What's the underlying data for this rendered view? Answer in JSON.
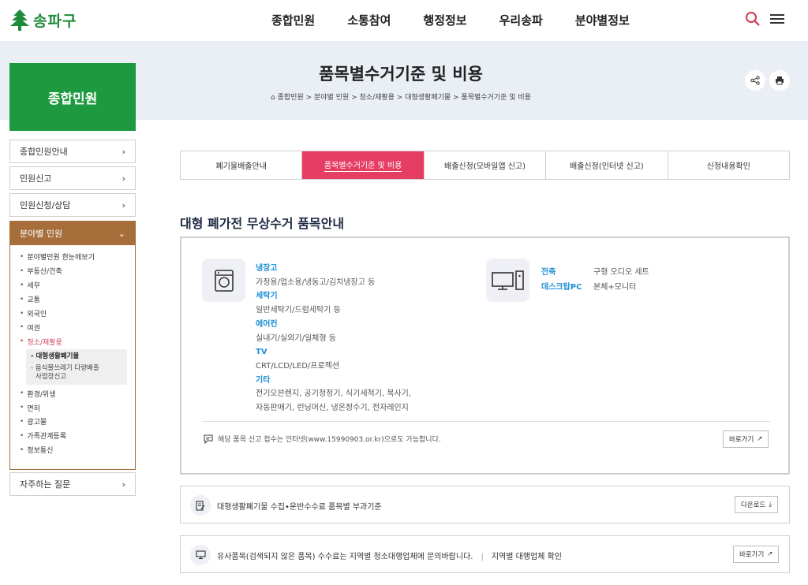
{
  "header": {
    "logo_text": "송파구",
    "nav": [
      "종합민원",
      "소통참여",
      "행정정보",
      "우리송파",
      "분야별정보"
    ],
    "search_icon_color": "#d2455e"
  },
  "page": {
    "title": "품목별수거기준 및 비용",
    "breadcrumb": "종합민원 > 분야별 민원 > 청소/재활용 > 대형생활폐기물 > 품목별수거기준 및 비용"
  },
  "lnb": {
    "title": "종합민원",
    "items_top": [
      "종합민원안내",
      "민원신고",
      "민원신청/상담"
    ],
    "active_label": "분야별 민원",
    "sub_items_a": [
      "분야별민원 한눈에보기",
      "부동산/건축",
      "세무",
      "교통",
      "외국인",
      "여권",
      "청소/재활용"
    ],
    "sub_sub_current": "- 대형생활폐기물",
    "sub_sub_other_1": "- 음식물쓰레기 다량배출",
    "sub_sub_other_2": "사업장신고",
    "sub_items_b": [
      "환경/위생",
      "면허",
      "광고물",
      "가족관계등록",
      "정보통신"
    ],
    "faq_label": "자주하는 질문"
  },
  "tabs": [
    "폐기물배출안내",
    "품목별수거기준 및 비용",
    "배출신청(모바일앱 신고)",
    "배출신청(인터넷 신고)",
    "신청내용확인"
  ],
  "section": {
    "title": "대형 폐가전 무상수거 품목안내",
    "categories": [
      {
        "name": "냉장고",
        "desc": [
          "가정용/업소용/냉동고/김치냉장고 등"
        ]
      },
      {
        "name": "세탁기",
        "desc": [
          "일반세탁기/드럼세탁기 등"
        ]
      },
      {
        "name": "에어컨",
        "desc": [
          "실내기/실외기/일체형 등"
        ]
      },
      {
        "name": "TV",
        "desc": [
          "CRT/LCD/LED/프로젝션"
        ]
      },
      {
        "name": "기타",
        "desc": [
          "전기오븐렌지, 공기청정기, 식기세척기, 복사기,",
          "자동판매기, 런닝머신, 냉온정수기, 전자레인지"
        ]
      }
    ],
    "right": [
      {
        "k": "전축",
        "v": "구형 오디오 세트"
      },
      {
        "k": "데스크탑PC",
        "v": "본체+모니터"
      }
    ],
    "notice": "해당 품목 신고 접수는 인터넷(www.15990903.or.kr)으로도 가능합니다.",
    "notice_btn": "바로가기"
  },
  "bars": [
    {
      "text": "대형생활폐기물 수집•운반수수료 품목별 부과기준",
      "btn": "다운로드"
    },
    {
      "text": "유사품목(검색되지 않은 품목) 수수료는 지역별 청소대행업체에 문의바랍니다.",
      "link": "지역별 대행업체 확인",
      "btn": "바로가기"
    }
  ],
  "colors": {
    "accent": "#e63d62",
    "green": "#1d9a3f",
    "brown": "#a66e3a",
    "blue": "#1d8fd6"
  }
}
